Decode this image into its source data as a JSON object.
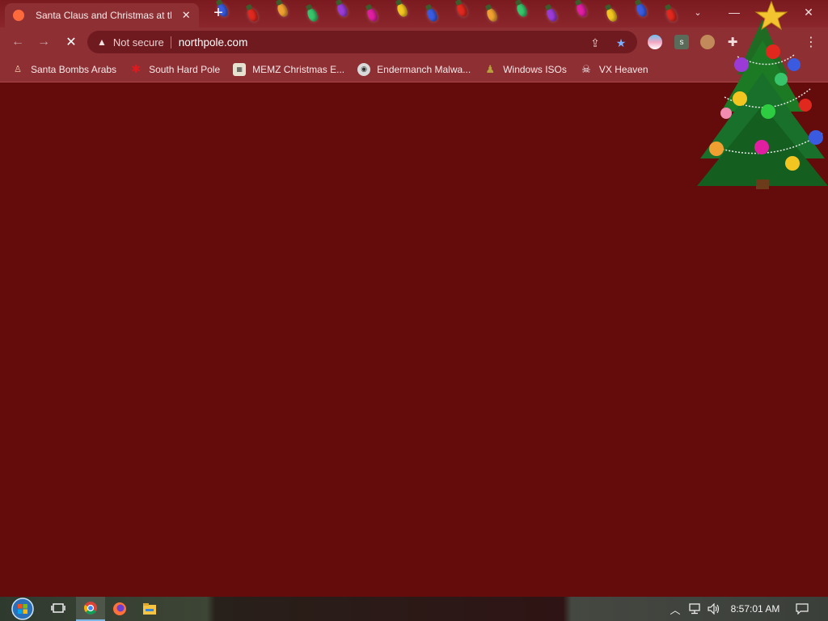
{
  "window": {
    "tab_title": "Santa Claus and Christmas at the",
    "tab_close": "✕",
    "new_tab": "+",
    "tab_search": "⌄",
    "minimize": "—",
    "close": "✕"
  },
  "toolbar": {
    "back": "←",
    "forward": "→",
    "stop": "✕",
    "security_icon": "▲",
    "security_label": "Not secure",
    "url": "northpole.com",
    "share_icon": "⇪",
    "bookmark_icon": "★",
    "menu_icon": "⋮",
    "extension_s": "s"
  },
  "bookmarks": [
    {
      "label": "Santa Bombs Arabs",
      "icon": "santa-icon"
    },
    {
      "label": "South Hard Pole",
      "icon": "snowflake-icon"
    },
    {
      "label": "MEMZ Christmas E...",
      "icon": "memz-icon"
    },
    {
      "label": "Endermanch Malwa...",
      "icon": "raccoon-icon"
    },
    {
      "label": "Windows ISOs",
      "icon": "windows-iso-icon"
    },
    {
      "label": "VX Heaven",
      "icon": "vx-heaven-icon"
    }
  ],
  "taskbar": {
    "time": "8:57:01 AM",
    "tray_chevron": "^",
    "items": [
      "start-orb",
      "task-view",
      "chrome",
      "firefox",
      "file-explorer"
    ]
  },
  "colors": {
    "page_bg": "#640b0b",
    "toolbar_bg": "#8e2f34",
    "bookmark_star": "#7ab0ff"
  }
}
